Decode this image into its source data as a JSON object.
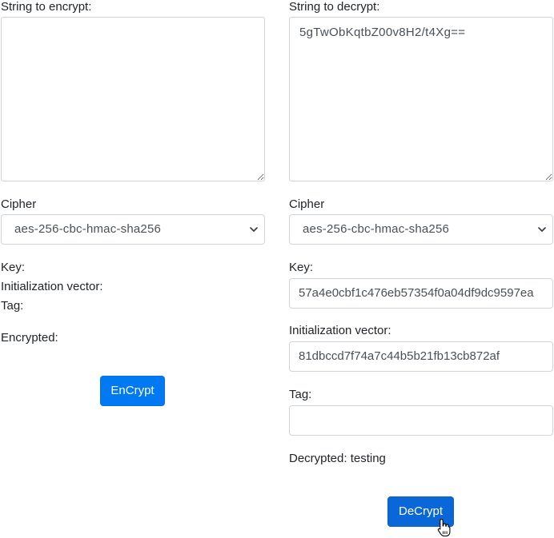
{
  "encrypt": {
    "string_label": "String to encrypt:",
    "string_value": "",
    "cipher_label": "Cipher",
    "cipher_selected": "aes-256-cbc-hmac-sha256",
    "key_label": "Key:",
    "iv_label": "Initialization vector:",
    "tag_label": "Tag:",
    "encrypted_label": "Encrypted:",
    "button_label": "EnCrypt"
  },
  "decrypt": {
    "string_label": "String to decrypt:",
    "string_value": "5gTwObKqtbZ00v8H2/t4Xg==",
    "cipher_label": "Cipher",
    "cipher_selected": "aes-256-cbc-hmac-sha256",
    "key_label": "Key:",
    "key_value": "57a4e0cbf1c476eb57354f0a04df9dc9597ea",
    "iv_label": "Initialization vector:",
    "iv_value": "81dbccd7f74a7c44b5b21fb13cb872af",
    "tag_label": "Tag:",
    "tag_value": "",
    "decrypted_label": "Decrypted: testing",
    "button_label": "DeCrypt"
  },
  "icons": {
    "select_chevron": "chevron-down-icon",
    "resize_handle": "resize-grip-icon",
    "cursor": "hand-pointer-icon"
  },
  "colors": {
    "primary_button": "#0079f2",
    "primary_button_hover": "#0a67d8",
    "border": "#ced4da",
    "text": "#212529"
  }
}
